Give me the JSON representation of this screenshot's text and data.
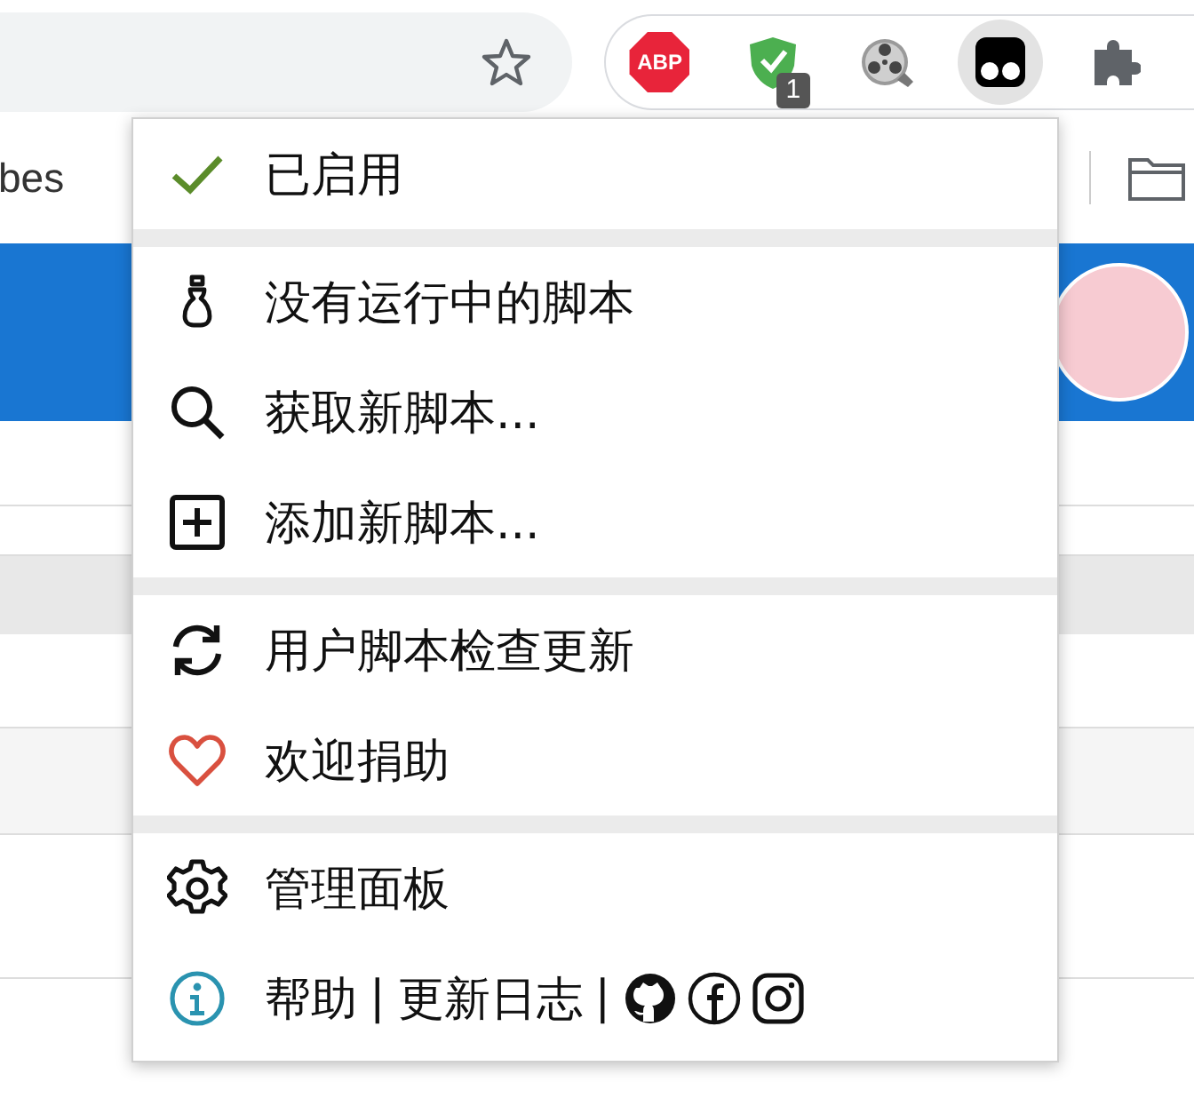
{
  "toolbar": {
    "extensions": [
      {
        "kind": "abp",
        "label": "ABP",
        "selected": false
      },
      {
        "kind": "shield",
        "badge": "1",
        "selected": false
      },
      {
        "kind": "reel",
        "selected": false
      },
      {
        "kind": "monkey",
        "selected": true
      },
      {
        "kind": "puzzle",
        "selected": false
      }
    ]
  },
  "bookmarks_bar": {
    "text": "bes"
  },
  "menu": {
    "sections": [
      [
        {
          "kind": "status",
          "label": "已启用",
          "checked": true
        }
      ],
      [
        {
          "kind": "empty",
          "label": "没有运行中的脚本"
        },
        {
          "kind": "search",
          "label": "获取新脚本..."
        },
        {
          "kind": "add",
          "label": "添加新脚本..."
        }
      ],
      [
        {
          "kind": "update",
          "label": "用户脚本检查更新"
        },
        {
          "kind": "donate",
          "label": "欢迎捐助"
        }
      ],
      [
        {
          "kind": "dashboard",
          "label": "管理面板"
        },
        {
          "kind": "footer",
          "parts": [
            {
              "kind": "link",
              "text": "帮助"
            },
            {
              "kind": "sep",
              "text": "|"
            },
            {
              "kind": "link",
              "text": "更新日志"
            },
            {
              "kind": "sep",
              "text": "|"
            },
            {
              "kind": "github"
            },
            {
              "kind": "facebook"
            },
            {
              "kind": "instagram"
            }
          ]
        }
      ]
    ]
  }
}
